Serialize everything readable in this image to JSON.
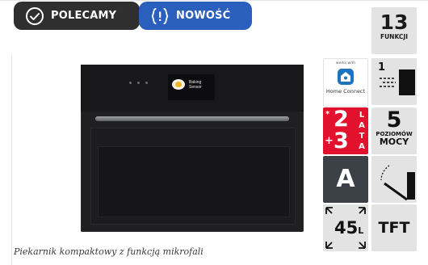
{
  "badges": {
    "recommended": {
      "label": "POLECAMY",
      "color": "#2f2f2f"
    },
    "new": {
      "label": "NOWOŚĆ",
      "color": "#2b5fbd"
    }
  },
  "product": {
    "caption": "Piekarnik kompaktowy z funkcją mikrofali",
    "display_text_line1": "Baking",
    "display_text_line2": "Sensor"
  },
  "features": {
    "functions": {
      "number": "13",
      "label": "FUNKCJI"
    },
    "home_connect": {
      "top_text": "works with",
      "label": "Home Connect"
    },
    "wifi": {
      "number": "1"
    },
    "warranty": {
      "star": "*",
      "base": "2",
      "plus": "+",
      "extra": "3",
      "label": [
        "L",
        "A",
        "T",
        "A"
      ],
      "color": "#e2122e"
    },
    "power_levels": {
      "number": "5",
      "label1": "POZIOMÓW",
      "label2": "MOCY"
    },
    "energy_class": {
      "letter": "A"
    },
    "width": {
      "value": "45",
      "unit": "L"
    },
    "display": {
      "label": "TFT"
    }
  }
}
